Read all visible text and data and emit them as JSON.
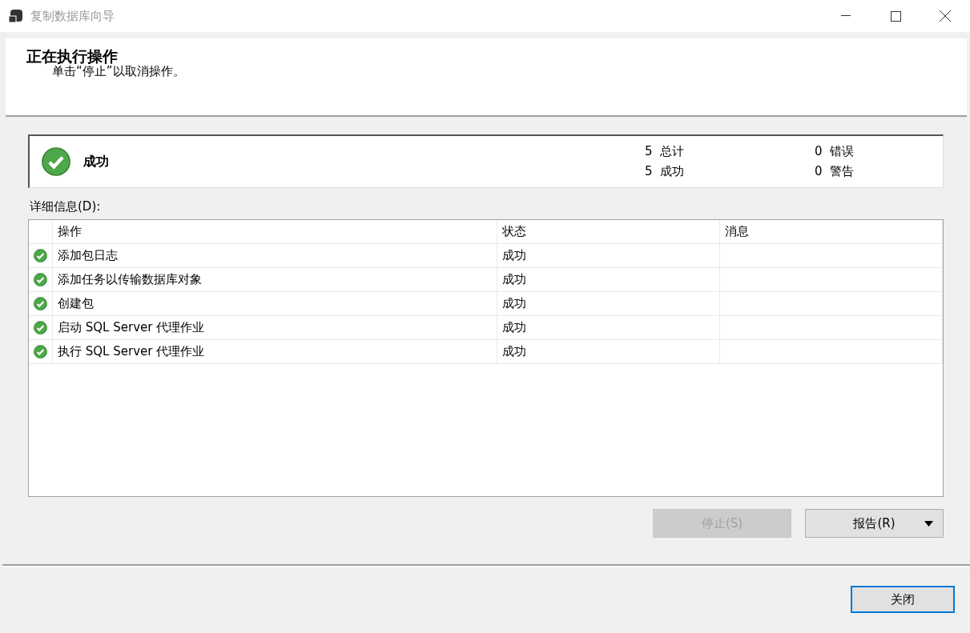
{
  "window": {
    "title": "复制数据库向导"
  },
  "header": {
    "title": "正在执行操作",
    "subtitle": "单击“停止”以取消操作。"
  },
  "summary": {
    "kind": "success",
    "label": "成功",
    "stats": [
      {
        "count": "5",
        "label": "总计"
      },
      {
        "count": "0",
        "label": "错误"
      },
      {
        "count": "5",
        "label": "成功"
      },
      {
        "count": "0",
        "label": "警告"
      }
    ]
  },
  "details_label": "详细信息(D):",
  "table": {
    "columns": [
      "操作",
      "状态",
      "消息"
    ],
    "rows": [
      {
        "kind": "success",
        "action": "添加包日志",
        "state": "成功"
      },
      {
        "kind": "success",
        "action": "添加任务以传输数据库对象",
        "state": "成功"
      },
      {
        "kind": "success",
        "action": "创建包",
        "state": "成功"
      },
      {
        "kind": "success",
        "action": "启动 SQL Server 代理作业",
        "state": "成功"
      },
      {
        "kind": "success",
        "action": "执行 SQL Server 代理作业",
        "state": "成功"
      }
    ]
  },
  "actions": {
    "stop": {
      "label": "停止(S)",
      "disabled": true
    },
    "report": {
      "label": "报告(R)",
      "disabled": false
    }
  },
  "close": {
    "label": "关闭",
    "focused": true
  }
}
